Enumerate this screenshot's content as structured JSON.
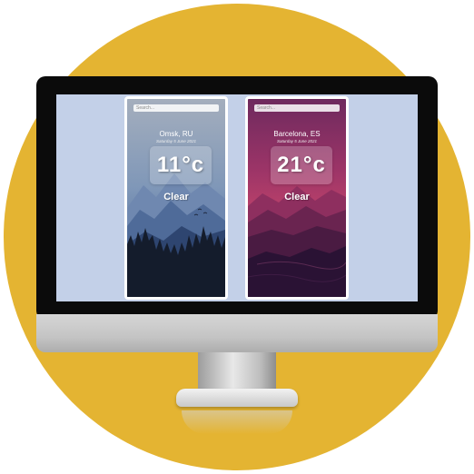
{
  "cards": [
    {
      "search_placeholder": "Search...",
      "city": "Omsk, RU",
      "date": "Saturday 5 June 2021",
      "temperature": "11°c",
      "condition": "Clear",
      "theme": "blue-mountain-forest",
      "colors": {
        "sky_top": "#8fa3bf",
        "sky_bottom": "#5f7ea8",
        "forest": "#141c2c"
      }
    },
    {
      "search_placeholder": "Search...",
      "city": "Barcelona, ES",
      "date": "Saturday 5 June 2021",
      "temperature": "21°c",
      "condition": "Clear",
      "theme": "magenta-mountain-lake",
      "colors": {
        "sky_top": "#7c2c63",
        "sky_bottom": "#b8406a",
        "lake": "#241233"
      }
    }
  ],
  "colors": {
    "badge": "#e4b432",
    "screen": "#c3d0e8",
    "bezel": "#0b0b0b"
  }
}
